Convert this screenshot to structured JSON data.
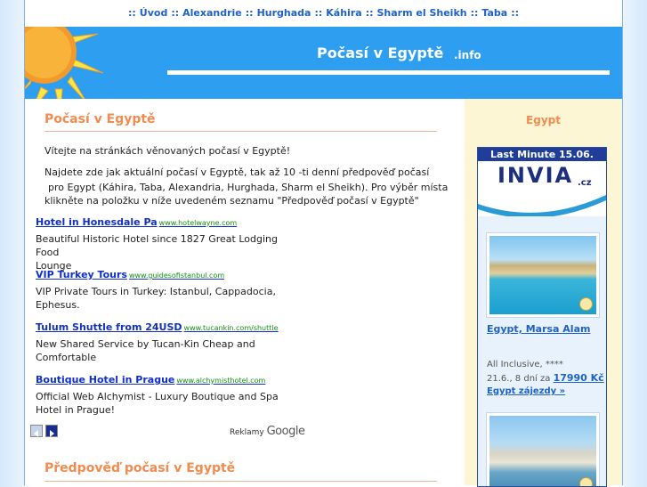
{
  "nav": {
    "prefix": "::",
    "items": [
      {
        "label": "Úvod"
      },
      {
        "label": "Alexandrie"
      },
      {
        "label": "Hurghada"
      },
      {
        "label": "Káhira"
      },
      {
        "label": "Sharm el Sheikh"
      },
      {
        "label": "Taba"
      }
    ],
    "suffix": "::"
  },
  "banner": {
    "title": "Počasí v Egyptě",
    "suffix": ".info"
  },
  "main": {
    "heading": "Počasí v Egyptě",
    "intro": "Vítejte na stránkách věnovaných počasí v Egyptě!",
    "para_line1": "Najdete zde jak aktuální počasí v Egyptě, tak až 10 -ti denní předpověď počasí",
    "para_line2": "pro Egypt (Káhira, Taba, Alexandria, Hurghada, Sharm el Sheikh). Pro výběr místa",
    "para_line3": "klikněte na položku v níže uvedeném seznamu \"Předpověď počasí v Egyptě\"",
    "forecast_heading": "Předpověď počasí v Egyptě"
  },
  "ads": [
    {
      "title": "Hotel in Honesdale Pa",
      "url": "www.hotelwayne.com",
      "desc1": "Beautiful Historic Hotel since 1827 Great Lodging Food",
      "desc2": "Lounge"
    },
    {
      "title": "VIP Turkey Tours",
      "url": "www.guidesofistanbul.com",
      "desc1": "VIP Private Tours in Turkey: Istanbul, Cappadocia,",
      "desc2": "Ephesus."
    },
    {
      "title": "Tulum Shuttle from 24USD",
      "url": "www.tucankin.com/shuttle",
      "desc1": "New Shared Service by Tucan-Kin Cheap and",
      "desc2": "Comfortable"
    },
    {
      "title": "Boutique Hotel in Prague",
      "url": "www.alchymisthotel.com",
      "desc1": "Official Web Alchymist - Luxury Boutique and Spa",
      "desc2": "Hotel in Prague!"
    }
  ],
  "ads_footer": {
    "reklamy": "Reklamy",
    "google": "Google"
  },
  "sidebar": {
    "heading": "Egypt",
    "last_minute": "Last Minute 15.06.",
    "logo": "INVIA",
    "logo_suffix": ".cz",
    "offer": {
      "title": "Egypt, Marsa Alam",
      "type": "All Inclusive, ****",
      "dates": "21.6., 8 dní za",
      "price": "17990 Kč",
      "link": "Egypt zájezdy »"
    }
  },
  "colors": {
    "accent_orange": "#f08c50",
    "link_blue": "#1030c8",
    "banner_blue": "#2d9ef0",
    "sidebar_bg": "#fdf6d4",
    "invia_navy": "#1f3d99"
  },
  "icons": [
    "sun-icon",
    "prev-arrow-icon",
    "next-arrow-icon",
    "zoom-icon"
  ]
}
